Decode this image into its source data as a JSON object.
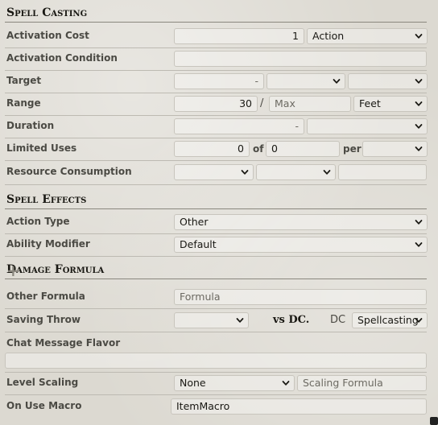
{
  "sections": {
    "spell_casting": "Spell Casting",
    "spell_effects": "Spell Effects",
    "damage_formula": "Damage Formula"
  },
  "activation_cost": {
    "label": "Activation Cost",
    "value": "1",
    "type": "Action"
  },
  "activation_condition": {
    "label": "Activation Condition",
    "value": ""
  },
  "target": {
    "label": "Target",
    "value": "-",
    "units": "",
    "type": ""
  },
  "range": {
    "label": "Range",
    "value": "30",
    "separator": "/",
    "long_placeholder": "Max",
    "units": "Feet"
  },
  "duration": {
    "label": "Duration",
    "value": "-",
    "units": ""
  },
  "limited_uses": {
    "label": "Limited Uses",
    "value": "0",
    "of_text": "of",
    "max": "0",
    "per_text": "per",
    "per": ""
  },
  "resource_consumption": {
    "label": "Resource Consumption",
    "type": "",
    "target": "",
    "amount": ""
  },
  "action_type": {
    "label": "Action Type",
    "value": "Other"
  },
  "ability_modifier": {
    "label": "Ability Modifier",
    "value": "Default"
  },
  "damage_formula": {
    "add_icon": "plus-icon",
    "add_glyph": "+"
  },
  "other_formula": {
    "label": "Other Formula",
    "placeholder": "Formula"
  },
  "saving_throw": {
    "label": "Saving Throw",
    "ability": "",
    "vs_text": "vs DC.",
    "dc_text": "DC",
    "scaling": "Spellcasting"
  },
  "chat_flavor": {
    "label": "Chat Message Flavor",
    "value": ""
  },
  "level_scaling": {
    "label": "Level Scaling",
    "mode": "None",
    "formula_placeholder": "Scaling Formula"
  },
  "on_use_macro": {
    "label": "On Use Macro",
    "value": "ItemMacro"
  },
  "colors": {
    "background": "#dcd9d1",
    "text": "#191813",
    "label": "#4b4a44"
  }
}
